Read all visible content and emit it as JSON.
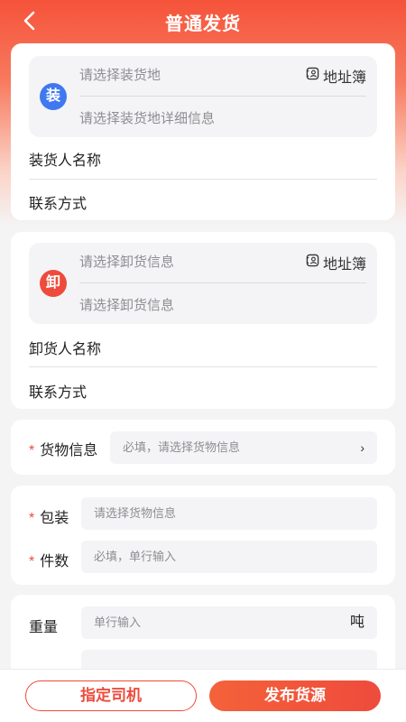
{
  "header": {
    "title": "普通发货"
  },
  "loading": {
    "badge": "装",
    "address_placeholder": "请选择装货地",
    "detail_placeholder": "请选择装货地详细信息",
    "address_book": "地址簿",
    "name_label": "装货人名称",
    "contact_label": "联系方式"
  },
  "unloading": {
    "badge": "卸",
    "address_placeholder": "请选择卸货信息",
    "detail_placeholder": "请选择卸货信息",
    "address_book": "地址簿",
    "name_label": "卸货人名称",
    "contact_label": "联系方式"
  },
  "cargo": {
    "required_mark": "*",
    "label": "货物信息",
    "placeholder": "必填，请选择货物信息",
    "chevron": "›"
  },
  "packaging": {
    "required_mark": "*",
    "label": "包装",
    "placeholder": "请选择货物信息"
  },
  "pieces": {
    "required_mark": "*",
    "label": "件数",
    "placeholder": "必填，单行输入"
  },
  "weight": {
    "label": "重量",
    "placeholder": "单行输入",
    "unit": "吨"
  },
  "actions": {
    "assign_driver": "指定司机",
    "publish": "发布货源"
  },
  "colors": {
    "accent": "#ee4b3c",
    "loading_badge": "#3f78f0",
    "unloading_badge": "#ee4b3c"
  }
}
